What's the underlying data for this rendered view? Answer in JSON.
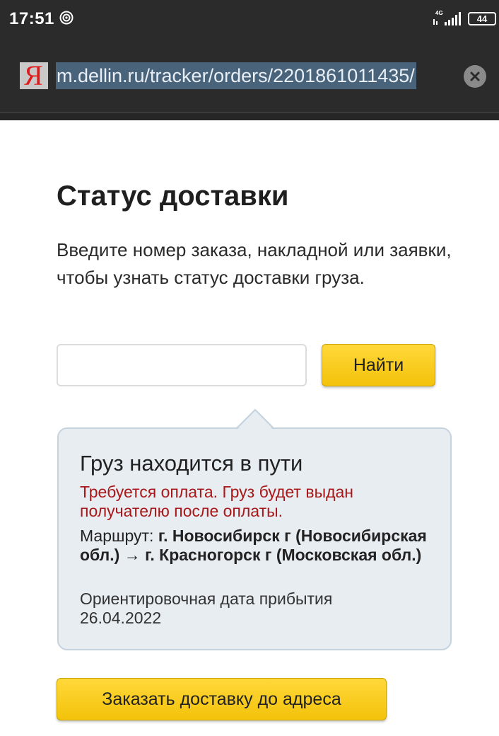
{
  "status_bar": {
    "time": "17:51",
    "network": "4G",
    "battery": "44",
    "icons": [
      "target-icon",
      "signal-icon",
      "battery-icon"
    ]
  },
  "browser": {
    "logo_letter": "Я",
    "url": "m.dellin.ru/tracker/orders/2201861011435/",
    "clear_icon": "close-icon"
  },
  "page": {
    "title": "Статус доставки",
    "subtitle": "Введите номер заказа, накладной или заявки, чтобы узнать статус доставки груза.",
    "search": {
      "value": "",
      "placeholder": ""
    },
    "find_button": "Найти",
    "status": {
      "heading": "Груз находится в пути",
      "warning": "Требуется оплата. Груз будет выдан получателю после оплаты.",
      "route_label": "Маршрут: ",
      "route_value": "г. Новосибирск г (Новосибирская обл.) → г. Красногорск г (Московская обл.)",
      "arrival_label": "Ориентировочная дата прибытия",
      "arrival_date": "26.04.2022"
    },
    "order_button": "Заказать доставку до адреса"
  },
  "colors": {
    "chrome_bg": "#2b2b2b",
    "url_highlight": "#49637a",
    "button_yellow": "#f3c20a",
    "bubble_bg": "#e8edf2",
    "warning_red": "#a81818"
  }
}
